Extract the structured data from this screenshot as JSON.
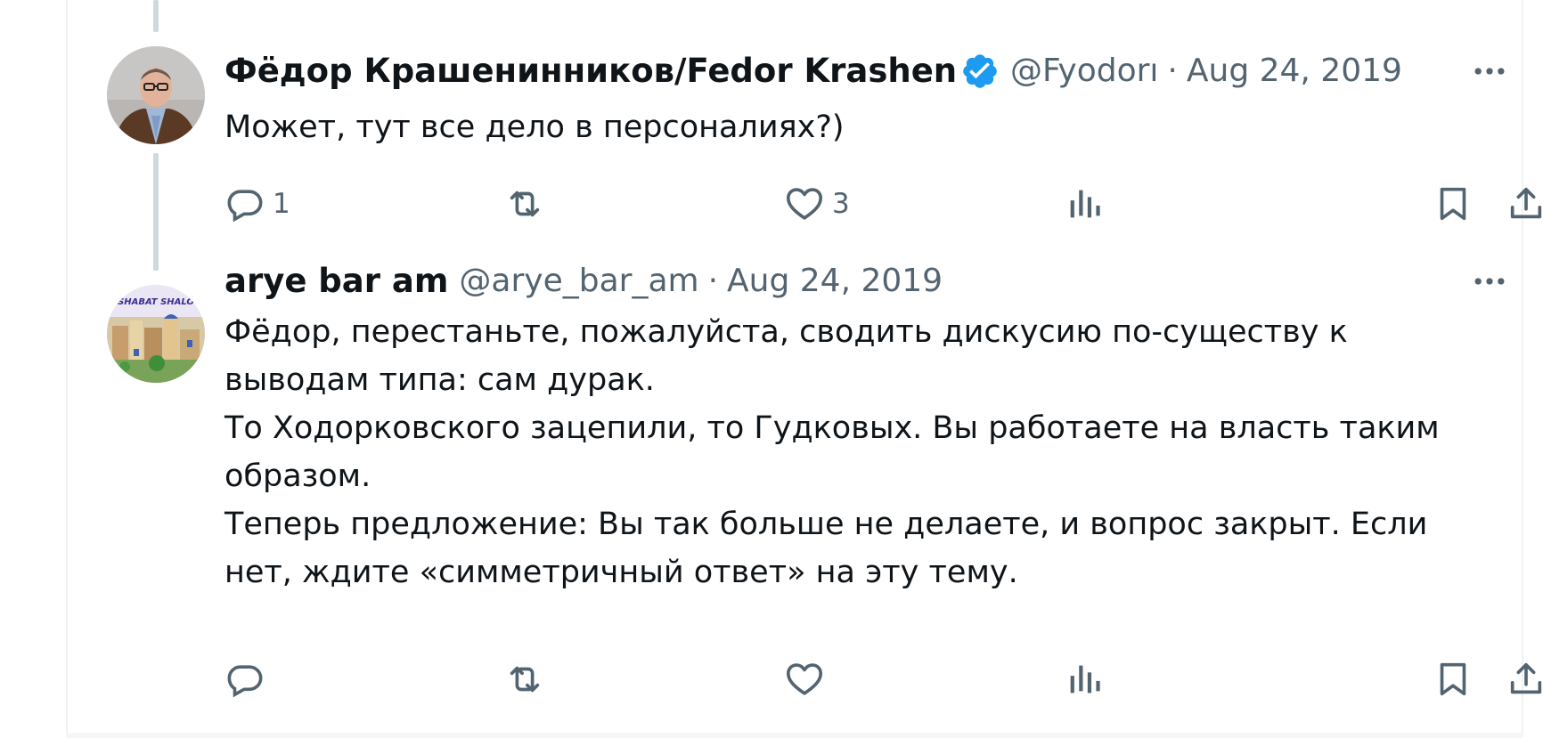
{
  "tweets": [
    {
      "display_name": "Фёдор Крашенинников/Fedor Krashenini",
      "verified": true,
      "handle": "@Fyodorı",
      "separator": "·",
      "date": "Aug 24, 2019",
      "text_lines": [
        "Может, тут все дело в персоналиях?)"
      ],
      "stats": {
        "replies": "1",
        "retweets": "",
        "likes": "3",
        "views": ""
      }
    },
    {
      "display_name": "arye bar am",
      "verified": false,
      "handle": "@arye_bar_am",
      "separator": "·",
      "date": "Aug 24, 2019",
      "avatar_caption": "SHABAT SHALO",
      "text_lines": [
        "Фёдор, перестаньте, пожалуйста, сводить дискусию по-существу к",
        "выводам типа: сам дурак.",
        "То Ходорковского зацепили, то Гудковых. Вы работаете на власть таким",
        "образом.",
        "Теперь предложение: Вы так больше не делаете, и вопрос закрыт. Если",
        "нет, ждите «симметричный ответ» на эту тему."
      ],
      "stats": {
        "replies": "",
        "retweets": "",
        "likes": "",
        "views": ""
      }
    }
  ],
  "icons": {
    "reply": "reply-icon",
    "retweet": "retweet-icon",
    "like": "heart-icon",
    "views": "views-icon",
    "bookmark": "bookmark-icon",
    "share": "share-icon",
    "more": "more-icon",
    "verified": "verified-badge-icon"
  },
  "colors": {
    "text": "#0f1419",
    "secondary": "#536471",
    "verified": "#1d9bf0",
    "thread_line": "#cfd9de",
    "border": "#eff3f4"
  }
}
